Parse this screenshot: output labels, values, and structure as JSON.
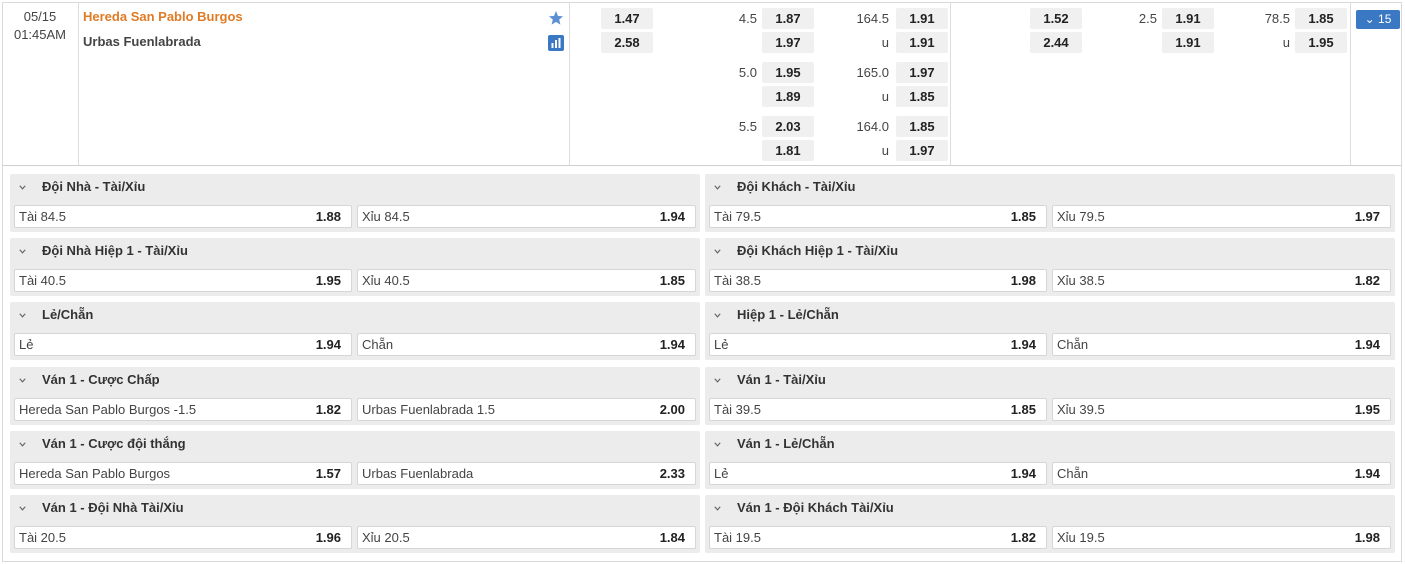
{
  "match": {
    "date": "05/15",
    "time": "01:45AM",
    "home_team": "Hereda San Pablo Burgos",
    "away_team": "Urbas Fuenlabrada",
    "more_count": "15",
    "moneyline": {
      "home": "1.47",
      "away": "2.58"
    },
    "handicap_rows": [
      {
        "line": "4.5",
        "home": "1.87",
        "away": "1.97"
      },
      {
        "line": "5.0",
        "home": "1.95",
        "away": "1.89"
      },
      {
        "line": "5.5",
        "home": "2.03",
        "away": "1.81"
      }
    ],
    "total_rows": [
      {
        "line": "164.5",
        "unit": "u",
        "over": "1.91",
        "under": "1.91"
      },
      {
        "line": "165.0",
        "unit": "u",
        "over": "1.97",
        "under": "1.85"
      },
      {
        "line": "164.0",
        "unit": "u",
        "over": "1.85",
        "under": "1.97"
      }
    ],
    "first_half": {
      "moneyline": {
        "home": "1.52",
        "away": "2.44"
      },
      "handicap": {
        "line": "2.5",
        "home": "1.91",
        "away": "1.91"
      },
      "total": {
        "line": "78.5",
        "unit": "u",
        "over": "1.85",
        "under": "1.95"
      }
    }
  },
  "markets": [
    {
      "title": "Đội Nhà - Tài/Xỉu",
      "left": {
        "label": "Tài 84.5",
        "odd": "1.88"
      },
      "right": {
        "label": "Xỉu 84.5",
        "odd": "1.94"
      }
    },
    {
      "title": "Đội Khách - Tài/Xỉu",
      "left": {
        "label": "Tài 79.5",
        "odd": "1.85"
      },
      "right": {
        "label": "Xỉu 79.5",
        "odd": "1.97"
      }
    },
    {
      "title": "Đội Nhà Hiệp 1 - Tài/Xỉu",
      "left": {
        "label": "Tài 40.5",
        "odd": "1.95"
      },
      "right": {
        "label": "Xỉu 40.5",
        "odd": "1.85"
      }
    },
    {
      "title": "Đội Khách Hiệp 1 - Tài/Xỉu",
      "left": {
        "label": "Tài 38.5",
        "odd": "1.98"
      },
      "right": {
        "label": "Xỉu 38.5",
        "odd": "1.82"
      }
    },
    {
      "title": "Lẻ/Chẵn",
      "left": {
        "label": "Lẻ",
        "odd": "1.94"
      },
      "right": {
        "label": "Chẵn",
        "odd": "1.94"
      }
    },
    {
      "title": "Hiệp 1 - Lẻ/Chẵn",
      "left": {
        "label": "Lẻ",
        "odd": "1.94"
      },
      "right": {
        "label": "Chẵn",
        "odd": "1.94"
      }
    },
    {
      "title": "Ván 1 - Cược Chấp",
      "left": {
        "label": "Hereda San Pablo Burgos -1.5",
        "odd": "1.82"
      },
      "right": {
        "label": "Urbas Fuenlabrada 1.5",
        "odd": "2.00"
      }
    },
    {
      "title": "Ván 1 - Tài/Xỉu",
      "left": {
        "label": "Tài 39.5",
        "odd": "1.85"
      },
      "right": {
        "label": "Xỉu 39.5",
        "odd": "1.95"
      }
    },
    {
      "title": "Ván 1 - Cược đội thắng",
      "left": {
        "label": "Hereda San Pablo Burgos",
        "odd": "1.57"
      },
      "right": {
        "label": "Urbas Fuenlabrada",
        "odd": "2.33"
      }
    },
    {
      "title": "Ván 1 - Lẻ/Chẵn",
      "left": {
        "label": "Lẻ",
        "odd": "1.94"
      },
      "right": {
        "label": "Chẵn",
        "odd": "1.94"
      }
    },
    {
      "title": "Ván 1 - Đội Nhà Tài/Xỉu",
      "left": {
        "label": "Tài 20.5",
        "odd": "1.96"
      },
      "right": {
        "label": "Xỉu 20.5",
        "odd": "1.84"
      }
    },
    {
      "title": "Ván 1 - Đội Khách Tài/Xỉu",
      "left": {
        "label": "Tài 19.5",
        "odd": "1.82"
      },
      "right": {
        "label": "Xỉu 19.5",
        "odd": "1.98"
      }
    }
  ],
  "colors": {
    "home_team": "#e07b25",
    "accent": "#3a78c3"
  }
}
